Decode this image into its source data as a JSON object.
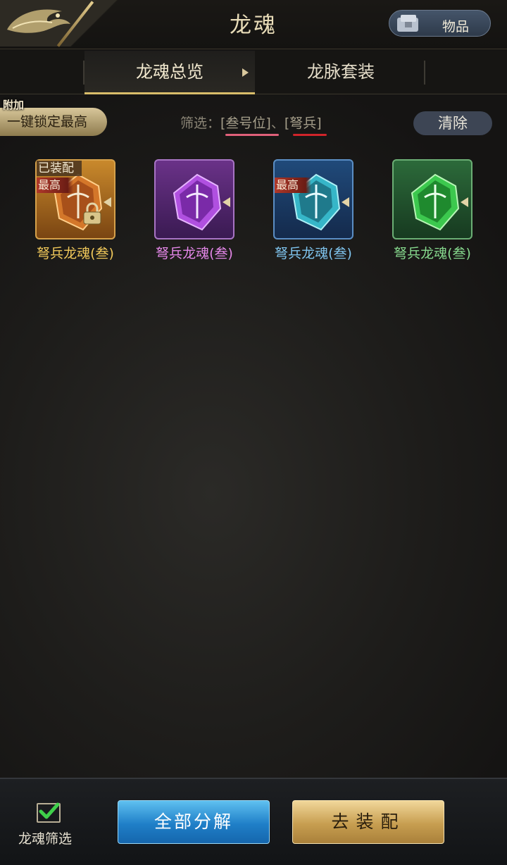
{
  "header": {
    "title": "龙魂",
    "items_label": "物品"
  },
  "tabs": [
    {
      "label": "龙魂总览",
      "active": true
    },
    {
      "label": "龙脉套装",
      "active": false
    }
  ],
  "toolbar": {
    "lock_tag": "附加",
    "lock_best_label": "一键锁定最高",
    "filter_prefix": "筛选：",
    "filter_chip_1": "[叁号位]",
    "filter_sep": "、",
    "filter_chip_2": "[弩兵]",
    "clear_label": "清除"
  },
  "soul_cards": [
    {
      "name": "弩兵龙魂(叁)",
      "rarity": "orange",
      "name_color": "#f0c85a",
      "equipped_label": "已装配",
      "best_label": "最高",
      "locked": true
    },
    {
      "name": "弩兵龙魂(叁)",
      "rarity": "purple",
      "name_color": "#e487e8",
      "locked": false
    },
    {
      "name": "弩兵龙魂(叁)",
      "rarity": "blue",
      "name_color": "#7fc4ee",
      "best_label": "最高",
      "locked": false
    },
    {
      "name": "弩兵龙魂(叁)",
      "rarity": "green",
      "name_color": "#86d88d",
      "locked": false
    }
  ],
  "bottom": {
    "filter_label": "龙魂筛选",
    "filter_checked": true,
    "decompose_label": "全部分解",
    "equip_label": "去装配"
  },
  "colors": {
    "accent_gold": "#d9bd6a",
    "blue_button": "#1f7fc8",
    "gold_button": "#c79e50"
  }
}
